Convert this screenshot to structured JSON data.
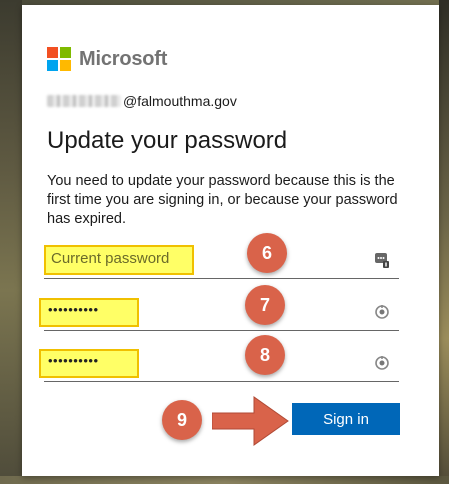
{
  "brand": {
    "name": "Microsoft"
  },
  "identity": {
    "email_suffix": "@falmouthma.gov"
  },
  "page": {
    "title": "Update your password",
    "description": "You need to update your password because this is the first time you are signing in, or because your password has expired."
  },
  "fields": {
    "current_password_placeholder": "Current password",
    "new_password_value": "••••••••••",
    "confirm_password_value": "••••••••••"
  },
  "annotations": {
    "step6": "6",
    "step7": "7",
    "step8": "8",
    "step9": "9"
  },
  "actions": {
    "signin_label": "Sign in"
  },
  "icons": {
    "current_password_icon": "password-manager-key-icon",
    "new_password_icon": "password-reveal-icon",
    "confirm_password_icon": "password-reveal-icon"
  },
  "colors": {
    "accent": "#0067b8",
    "annotation": "#d9634a",
    "highlight": "#ffff66"
  }
}
